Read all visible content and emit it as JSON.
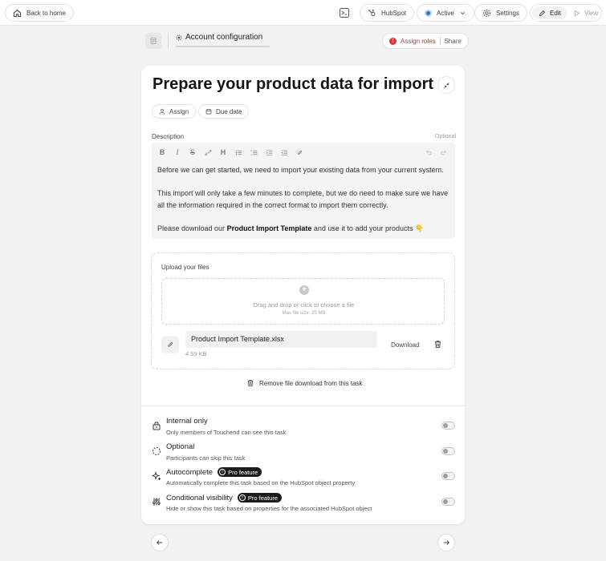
{
  "topbar": {
    "back_label": "Back to home",
    "hubspot_label": "HubSpot",
    "status_label": "Active",
    "settings_label": "Settings",
    "edit_label": "Edit",
    "view_label": "View"
  },
  "header": {
    "account_label": "Account configuration",
    "assign_roles_label": "Assign roles",
    "share_label": "Share"
  },
  "task": {
    "title": "Prepare your product data for import",
    "assign_label": "Assign",
    "due_date_label": "Due date",
    "description_label": "Description",
    "optional_label": "Optional",
    "description": {
      "p1": "Before we can get started, we need to import your existing data from your current system.",
      "p2": "This import will only take a few minutes to complete, but we do need to make sure we have all the information required in the correct format to import them correctly.",
      "p3_prefix": "Please download our ",
      "p3_bold": "Product Import Template",
      "p3_suffix": " and use it to add your products 👇"
    }
  },
  "upload": {
    "label": "Upload your files",
    "drop_text": "Drag and drop or click to choose a file",
    "max_size": "Max file size: 25 MB",
    "file_name": "Product Import Template.xlsx",
    "file_size": "4.59 KB",
    "download_label": "Download",
    "remove_label": "Remove file download from this task"
  },
  "options": [
    {
      "title": "Internal only",
      "subtitle": "Only members of Touchend can see this task",
      "badge": "",
      "enabled": false
    },
    {
      "title": "Optional",
      "subtitle": "Participants can skip this task",
      "badge": "",
      "enabled": false
    },
    {
      "title": "Autocomplete",
      "subtitle": "Automatically complete this task based on the HubSpot object property",
      "badge": "Pro feature",
      "enabled": false
    },
    {
      "title": "Conditional visibility",
      "subtitle": "Hide or show this task based on properties for the associated HubSpot object",
      "badge": "Pro feature",
      "enabled": false
    }
  ],
  "colors": {
    "accent_blue": "#2f6fd6",
    "alert_red": "#d83a3a",
    "badge_dark": "#1c1c1c",
    "page_bg": "#f2f2f1"
  },
  "icons": [
    "home-icon",
    "layout-icon",
    "hubspot-icon",
    "chevron-down-icon",
    "gear-icon",
    "pencil-icon",
    "play-icon",
    "gear-small-icon",
    "collapse-icon",
    "user-icon",
    "calendar-icon",
    "plus-circle-icon",
    "paperclip-icon",
    "trash-icon",
    "lock-icon",
    "dashed-circle-icon",
    "sparkle-icon",
    "sliders-icon",
    "arrow-left-icon",
    "arrow-right-icon"
  ]
}
